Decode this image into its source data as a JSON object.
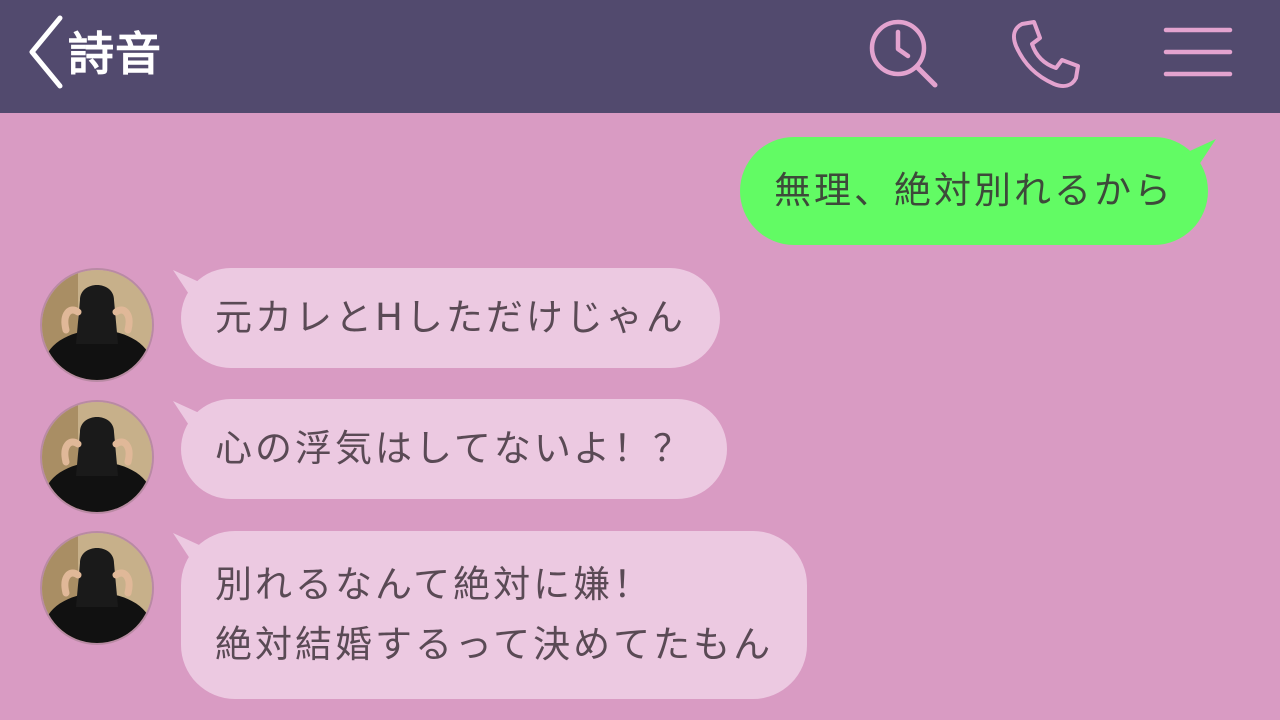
{
  "header": {
    "title": "詩音",
    "background_color": "#524a6e",
    "icons": [
      "chevron-left-icon",
      "clock-search-icon",
      "phone-icon",
      "menu-icon"
    ]
  },
  "chat": {
    "background_color": "#d99bc3",
    "outgoing_color": "#62fb64",
    "incoming_color": "#ecc9e1",
    "messages": [
      {
        "sender": "me",
        "text": "無理、絶対別れるから"
      },
      {
        "sender": "詩音",
        "text": "元カレとHしただけじゃん"
      },
      {
        "sender": "詩音",
        "text": "心の浮気はしてないよ！？"
      },
      {
        "sender": "詩音",
        "lines": [
          "別れるなんて絶対に嫌！",
          "絶対結婚するって決めてたもん"
        ]
      }
    ]
  }
}
